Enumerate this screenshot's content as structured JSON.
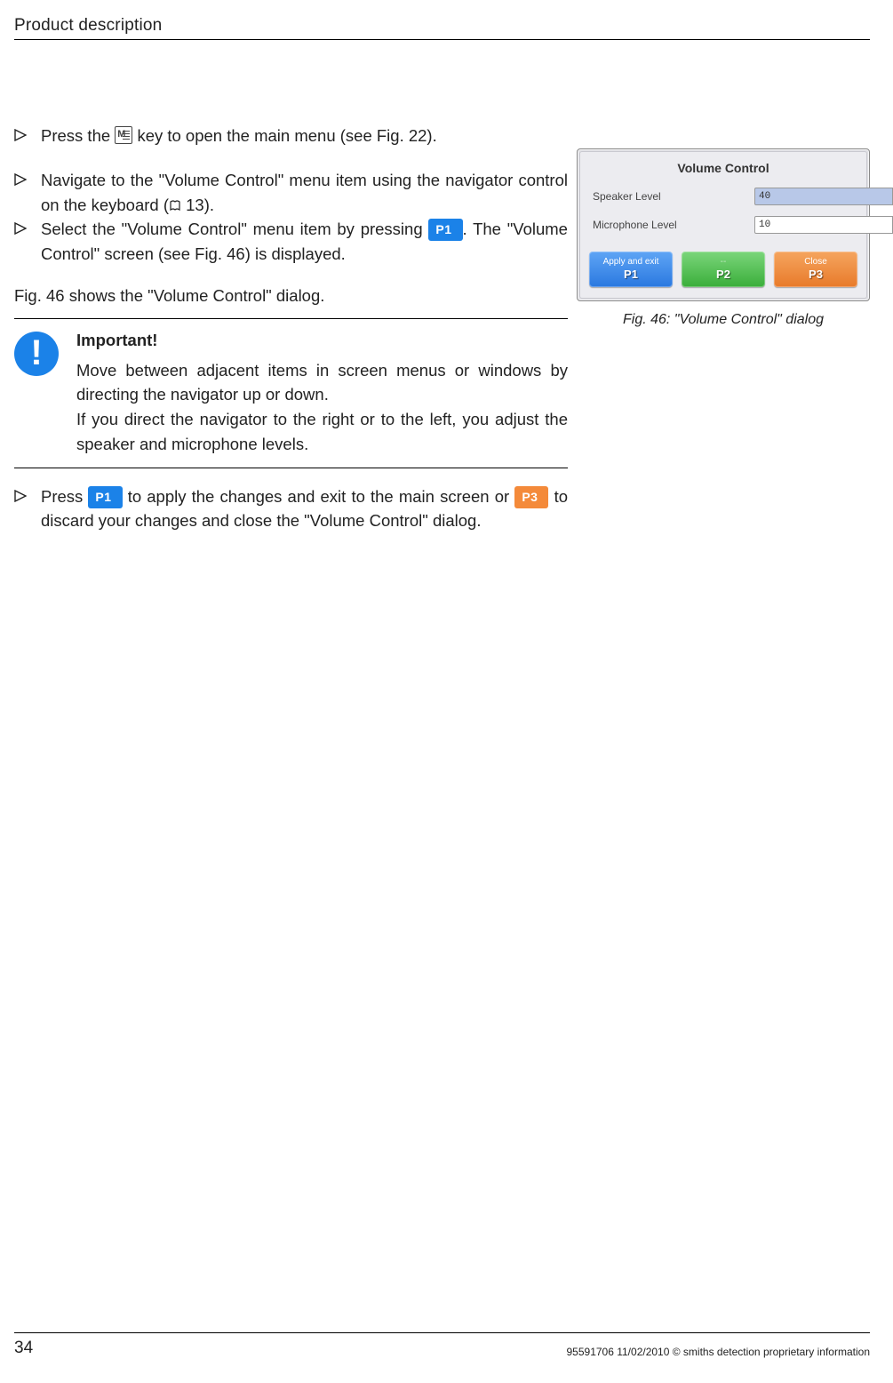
{
  "header": {
    "title": "Product description"
  },
  "steps": {
    "s1a": "Press the ",
    "s1b": " key to open the main menu (see Fig. 22).",
    "s2a": "Navigate to the \"Volume Control\" menu item using the navigator control on the keyboard (",
    "s2b": " 13).",
    "s3a": "Select the \"Volume Control\" menu item by pressing ",
    "s3b": ". The \"Volume Control\" screen (see Fig. 46) is displayed.",
    "s4a": "Press ",
    "s4b": " to apply the changes and exit to the main screen or ",
    "s4c": " to discard your changes and close the \"Volume Control\" dialog."
  },
  "caption_intro": "Fig. 46 shows the \"Volume Control\" dialog.",
  "important": {
    "heading": "Important!",
    "line1": "Move between adjacent items in screen menus or win­dows by directing the navigator up or down.",
    "line2": "If you direct the navigator to the right or to the left, you adjust the speaker and microphone levels."
  },
  "btns": {
    "p1": "P1",
    "p3": "P3"
  },
  "dialog": {
    "title": "Volume Control",
    "speaker_label": "Speaker Level",
    "speaker_value": "40",
    "mic_label": "Microphone Level",
    "mic_value": "10",
    "b1_top": "Apply and exit",
    "b1_bot": "P1",
    "b2_top": "--",
    "b2_bot": "P2",
    "b3_top": "Close",
    "b3_bot": "P3"
  },
  "fig_caption": "Fig. 46: \"Volume Control\" dialog",
  "footer": {
    "page": "34",
    "right": "95591706 11/02/2010 © smiths detection proprietary information"
  }
}
